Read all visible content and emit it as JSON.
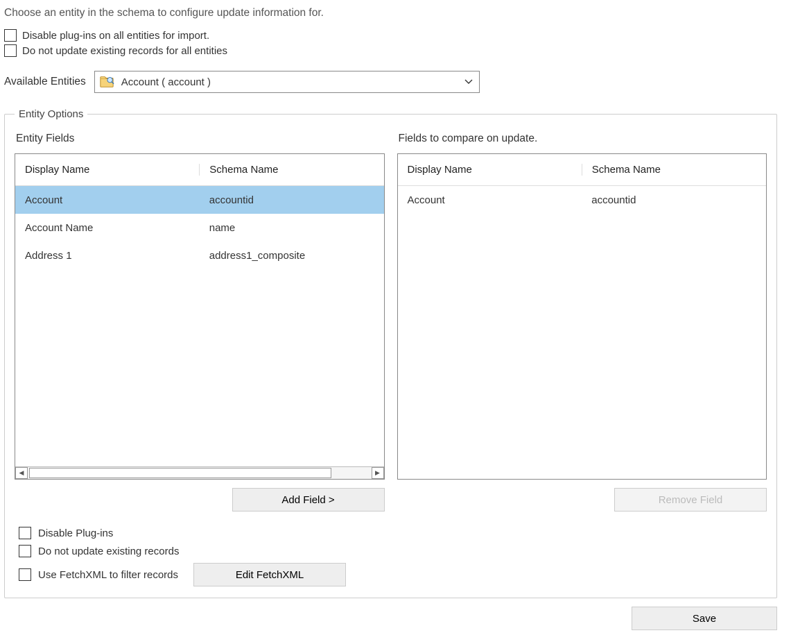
{
  "instruction": "Choose an entity in the schema to configure update information for.",
  "top_options": {
    "disable_plugins_all": "Disable plug-ins on all entities for import.",
    "no_update_all": "Do not update existing records for all entities"
  },
  "available": {
    "label": "Available Entities",
    "selected": "Account  ( account )"
  },
  "entity_options": {
    "legend": "Entity Options",
    "left_title": "Entity Fields",
    "right_title": "Fields to compare on update.",
    "columns": {
      "display": "Display Name",
      "schema": "Schema Name"
    },
    "left_rows": [
      {
        "display": "Account",
        "schema": "accountid",
        "selected": true
      },
      {
        "display": "Account Name",
        "schema": "name",
        "selected": false
      },
      {
        "display": "Address 1",
        "schema": "address1_composite",
        "selected": false
      }
    ],
    "right_rows": [
      {
        "display": "Account",
        "schema": "accountid",
        "selected": false
      }
    ],
    "add_field": "Add Field >",
    "remove_field": "Remove Field",
    "options": {
      "disable_plugins": "Disable Plug-ins",
      "no_update": "Do not update existing records",
      "use_fetchxml": "Use FetchXML to filter records",
      "edit_fetchxml": "Edit FetchXML"
    }
  },
  "buttons": {
    "save": "Save"
  }
}
